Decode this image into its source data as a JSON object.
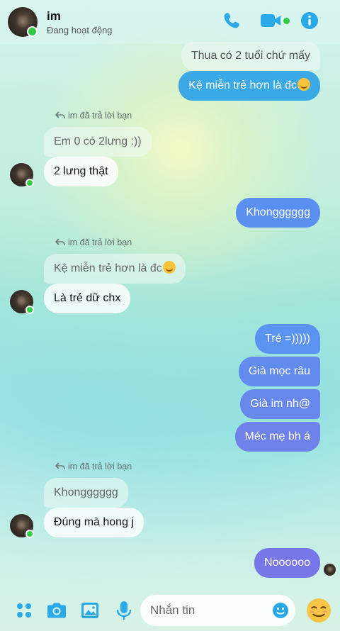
{
  "header": {
    "name": "im",
    "status": "Đang hoạt động",
    "accent": "#2aa9e8"
  },
  "reply_note": "im đã trả lời bạn",
  "messages": [
    {
      "text": "Thua có 2 tuổi chứ mấy",
      "side": "out",
      "style": "quoted"
    },
    {
      "text": "Kệ miễn trẻ hơn là đc",
      "emoji": "grinning-cat-emoji",
      "side": "out"
    },
    {
      "text": "Em 0 có 2lưng :))",
      "side": "in",
      "style": "quoted"
    },
    {
      "text": "2 lưng thật",
      "side": "in"
    },
    {
      "text": "Khongggggg",
      "side": "out"
    },
    {
      "text": "Kệ miễn trẻ hơn là đc",
      "emoji": "grinning-cat-emoji",
      "side": "in",
      "style": "quoted"
    },
    {
      "text": "Là trẻ dữ chx",
      "side": "in"
    },
    {
      "text": "Tré =)))))",
      "side": "out"
    },
    {
      "text": "Già mọc râu",
      "side": "out"
    },
    {
      "text": "Già im nh@",
      "side": "out"
    },
    {
      "text": "Méc mẹ bh á",
      "side": "out"
    },
    {
      "text": "Khongggggg",
      "side": "in",
      "style": "quoted"
    },
    {
      "text": "Đúng mà hong j",
      "side": "in"
    },
    {
      "text": "Noooooo",
      "side": "out"
    }
  ],
  "composer": {
    "placeholder": "Nhắn tin",
    "icons": [
      "apps-icon",
      "camera-icon",
      "gallery-icon",
      "microphone-icon",
      "emoji-icon",
      "quick-reaction-emoji"
    ]
  },
  "colors": {
    "outgoing_bubble": "#5b8ff0",
    "outgoing_bubble_top": "#3aa9e6",
    "outgoing_bubble_bottom": "#7777ea",
    "icon_blue": "#2aa9e8",
    "online": "#31cc46"
  }
}
